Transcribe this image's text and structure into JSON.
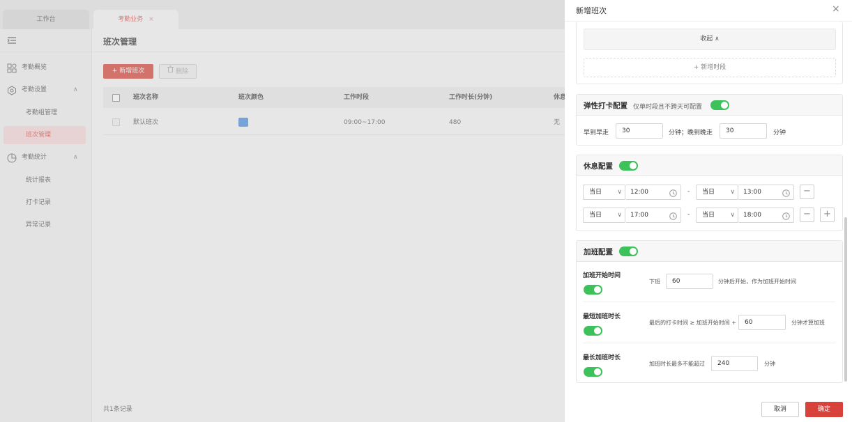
{
  "tabs": [
    {
      "label": "工作台"
    },
    {
      "label": "考勤业务",
      "close": "×"
    }
  ],
  "sidebar": {
    "items": [
      {
        "label": "考勤概览"
      },
      {
        "label": "考勤设置",
        "chevron": "∧"
      },
      {
        "label": "考勤组管理"
      },
      {
        "label": "班次管理"
      },
      {
        "label": "考勤统计",
        "chevron": "∧"
      },
      {
        "label": "统计报表"
      },
      {
        "label": "打卡记录"
      },
      {
        "label": "异常记录"
      }
    ]
  },
  "main": {
    "title": "班次管理",
    "add_label": "+ 新增班次",
    "delete_label": "删除",
    "columns": [
      "班次名称",
      "班次颜色",
      "工作时段",
      "工作时长(分钟)",
      "休息"
    ],
    "rows": [
      {
        "name": "默认班次",
        "color": "#4a90e2",
        "period": "09:00~17:00",
        "duration": "480",
        "rest": "无"
      }
    ],
    "total": "共1条记录"
  },
  "drawer": {
    "title": "新增班次",
    "collapse_label": "收起 ∧",
    "add_period_label": "+ 新增时段",
    "flex": {
      "title": "弹性打卡配置",
      "note": "仅单时段且不跨天可配置",
      "early_label": "早到早走",
      "early_value": "30",
      "mid_text": "分钟；晚到晚走",
      "late_value": "30",
      "unit": "分钟"
    },
    "rest": {
      "title": "休息配置",
      "rows": [
        {
          "day1": "当日",
          "t1": "12:00",
          "dash": "-",
          "day2": "当日",
          "t2": "13:00"
        },
        {
          "day1": "当日",
          "t1": "17:00",
          "dash": "-",
          "day2": "当日",
          "t2": "18:00"
        }
      ],
      "minus": "−",
      "plus": "+"
    },
    "overtime": {
      "title": "加班配置",
      "start": {
        "label": "加班开始时间",
        "prefix": "下班",
        "value": "60",
        "suffix": "分钟后开始，作为加班开始时间"
      },
      "min": {
        "label": "最短加班时长",
        "prefix": "最后的打卡时间 ≥ 加班开始时间 +",
        "value": "60",
        "suffix": "分钟才算加班"
      },
      "max": {
        "label": "最长加班时长",
        "prefix": "加班时长最多不能超过",
        "value": "240",
        "suffix": "分钟"
      }
    },
    "cancel": "取消",
    "ok": "确定"
  }
}
